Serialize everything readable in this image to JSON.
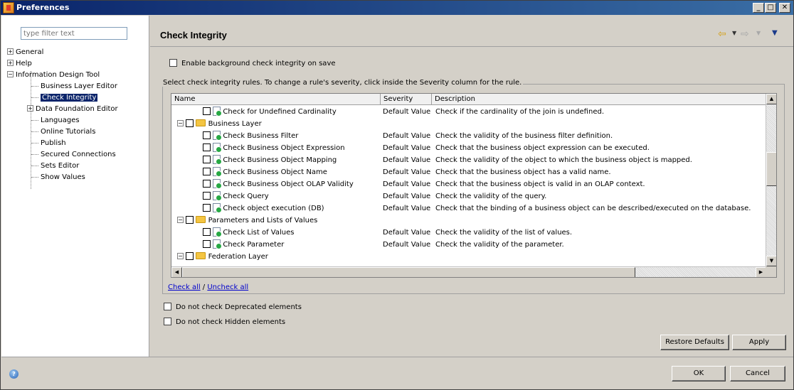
{
  "window": {
    "title": "Preferences",
    "buttons": {
      "minimize": "_",
      "maximize": "□",
      "close": "✕"
    }
  },
  "sidebar": {
    "filter_placeholder": "type filter text",
    "items": [
      {
        "label": "General",
        "expander": "+"
      },
      {
        "label": "Help",
        "expander": "+"
      },
      {
        "label": "Information Design Tool",
        "expander": "−"
      },
      {
        "label": "Business Layer Editor"
      },
      {
        "label": "Check Integrity",
        "selected": true
      },
      {
        "label": "Data Foundation Editor",
        "expander": "+"
      },
      {
        "label": "Languages"
      },
      {
        "label": "Online Tutorials"
      },
      {
        "label": "Publish"
      },
      {
        "label": "Secured Connections"
      },
      {
        "label": "Sets Editor"
      },
      {
        "label": "Show Values"
      }
    ]
  },
  "header": {
    "title": "Check Integrity",
    "nav_icons": [
      "back-arrow-icon",
      "back-dropdown-icon",
      "forward-arrow-icon",
      "forward-dropdown-icon",
      "view-menu-icon"
    ]
  },
  "main": {
    "enable_background_label": "Enable background check integrity on save",
    "group_title": "Select check integrity rules. To change a rule's severity, click inside the Severity column for the rule.",
    "columns": {
      "name": "Name",
      "severity": "Severity",
      "description": "Description"
    },
    "rows": [
      {
        "type": "rule",
        "name": "Check for Undefined Cardinality",
        "severity": "Default Value",
        "description": "Check if the cardinality of the join is undefined."
      },
      {
        "type": "group",
        "name": "Business Layer",
        "expander": "−"
      },
      {
        "type": "rule",
        "name": "Check Business Filter",
        "severity": "Default Value",
        "description": "Check the validity of the business filter definition."
      },
      {
        "type": "rule",
        "name": "Check Business Object Expression",
        "severity": "Default Value",
        "description": "Check that the business object expression can be executed."
      },
      {
        "type": "rule",
        "name": "Check Business Object Mapping",
        "severity": "Default Value",
        "description": "Check the validity of the object to which the business object is mapped."
      },
      {
        "type": "rule",
        "name": "Check Business Object Name",
        "severity": "Default Value",
        "description": "Check that the business object has a valid name."
      },
      {
        "type": "rule",
        "name": "Check Business Object OLAP Validity",
        "severity": "Default Value",
        "description": "Check that the business object is valid in an OLAP context."
      },
      {
        "type": "rule",
        "name": "Check Query",
        "severity": "Default Value",
        "description": "Check the validity of the query."
      },
      {
        "type": "rule",
        "name": "Check object execution (DB)",
        "severity": "Default Value",
        "description": "Check that the binding of a business object can be described/executed on the database."
      },
      {
        "type": "group",
        "name": "Parameters and Lists of Values",
        "expander": "−"
      },
      {
        "type": "rule",
        "name": "Check List of Values",
        "severity": "Default Value",
        "description": "Check the validity of the list of values."
      },
      {
        "type": "rule",
        "name": "Check Parameter",
        "severity": "Default Value",
        "description": "Check the validity of the parameter."
      },
      {
        "type": "group",
        "name": "Federation Layer",
        "expander": "−"
      }
    ],
    "check_all_label": "Check all",
    "link_separator": " / ",
    "uncheck_all_label": "Uncheck all",
    "deprecated_label": "Do not check Deprecated elements",
    "hidden_label": "Do not check Hidden elements",
    "restore_defaults_label": "Restore Defaults",
    "apply_label": "Apply"
  },
  "footer": {
    "ok_label": "OK",
    "cancel_label": "Cancel",
    "help_glyph": "?"
  }
}
